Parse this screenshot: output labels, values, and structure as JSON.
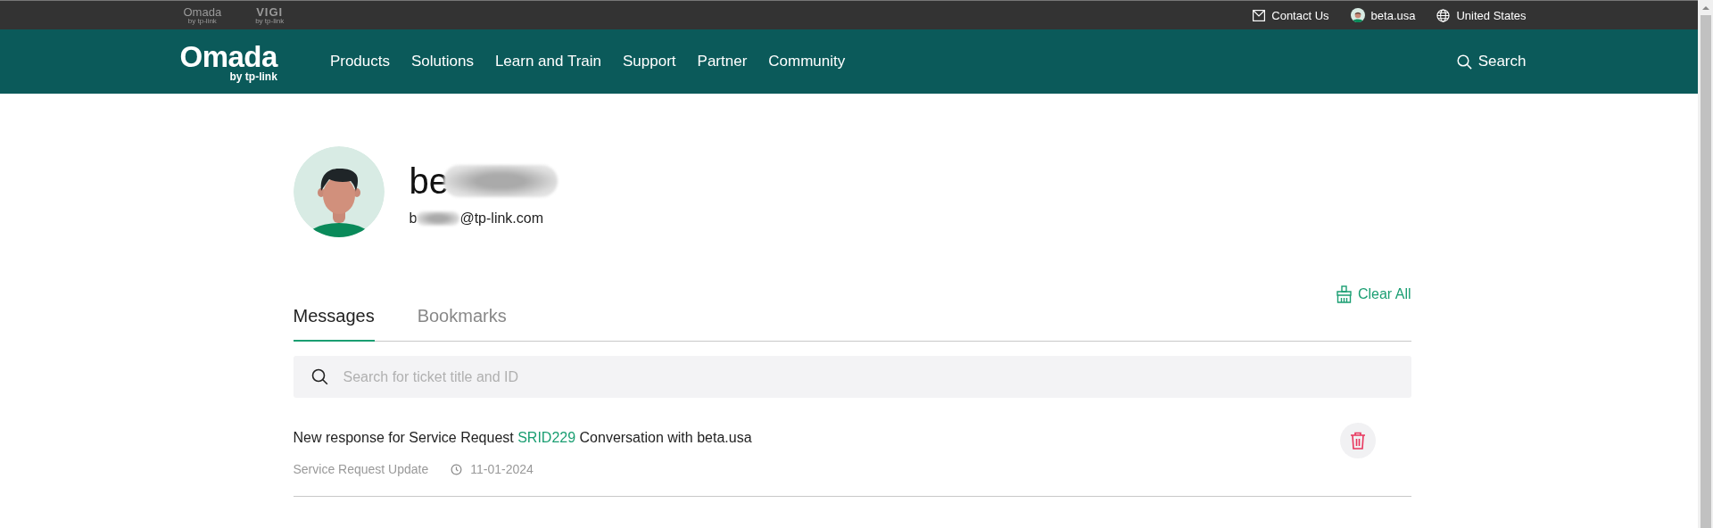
{
  "top_bar": {
    "brands": [
      {
        "kind": "omada-pro",
        "label": "Omada",
        "sub": "by tp-link"
      },
      {
        "kind": "vigi",
        "label": "VIGI",
        "sub": "by tp-link"
      }
    ],
    "links": [
      {
        "kind": "mail",
        "label": "Contact Us"
      },
      {
        "kind": "avatar",
        "label": "beta.usa"
      },
      {
        "kind": "globe",
        "label": "United States"
      }
    ]
  },
  "nav": {
    "logo": {
      "name": "Omada",
      "sub": "by tp-link"
    },
    "items": [
      "Products",
      "Solutions",
      "Learn and Train",
      "Support",
      "Partner",
      "Community"
    ],
    "search": "Search"
  },
  "profile": {
    "name": "be",
    "email_start": "b",
    "email_end": "@tp-link.com"
  },
  "tabs": [
    {
      "label": "Messages",
      "selected": true
    },
    {
      "label": "Bookmarks",
      "selected": false
    }
  ],
  "clear_all": "Clear All",
  "search": {
    "placeholder": "Search for ticket title and ID"
  },
  "messages": [
    {
      "title_start": "New response for Service Request ",
      "link": "SRID229",
      "title_end": " Conversation with beta.usa",
      "category": "Service Request Update",
      "date": "11-01-2024"
    }
  ]
}
